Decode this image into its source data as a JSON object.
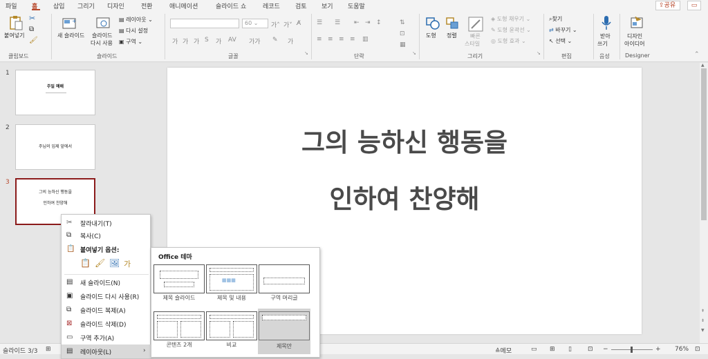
{
  "tabs": [
    "파일",
    "홈",
    "삽입",
    "그리기",
    "디자인",
    "전환",
    "애니메이션",
    "슬라이드 쇼",
    "레코드",
    "검토",
    "보기",
    "도움말"
  ],
  "share_label": "공유",
  "ribbon": {
    "paste_label": "붙여넣기",
    "new_slide_label": "새 슬라이드",
    "reuse_slides_label_1": "슬라이드",
    "reuse_slides_label_2": "다시 사용",
    "layout_label": "레이아웃",
    "reset_label": "다시 설정",
    "section_label": "구역",
    "font_size_value": "60",
    "shapes_label": "도형",
    "arrange_label": "정렬",
    "quick_styles_label_1": "빠른",
    "quick_styles_label_2": "스타일",
    "shape_fill_label": "도형 채우기",
    "shape_outline_label": "도형 윤곽선",
    "shape_effects_label": "도형 효과",
    "find_label": "찾기",
    "replace_label": "바꾸기",
    "select_label": "선택",
    "dictate_label_1": "받아",
    "dictate_label_2": "쓰기",
    "designer_label_1": "디자인",
    "designer_label_2": "아이디어",
    "groups": {
      "clipboard": "클립보드",
      "slides": "슬라이드",
      "font": "글꼴",
      "paragraph": "단락",
      "drawing": "그리기",
      "editing": "편집",
      "voice": "음성",
      "designer": "Designer"
    }
  },
  "thumbnails": [
    {
      "num": "1",
      "line1": "주일 예배",
      "line2": ""
    },
    {
      "num": "2",
      "line1": "주님의 입제 앞에서",
      "line2": ""
    },
    {
      "num": "3",
      "line1": "그의 능하신 행동을",
      "line2": "인하여 찬양해"
    }
  ],
  "slide": {
    "line1": "그의 능하신 행동을",
    "line2": "인하여 찬양해"
  },
  "context_menu": {
    "cut": "잘라내기(T)",
    "copy": "복사(C)",
    "paste_options": "붙여넣기 옵션:",
    "new_slide": "새 슬라이드(N)",
    "reuse_slides": "슬라이드 다시 사용(R)",
    "duplicate_slide": "슬라이드 복제(A)",
    "delete_slide": "슬라이드 삭제(D)",
    "add_section": "구역 추가(A)",
    "layout": "레이아웃(L)"
  },
  "layout_submenu": {
    "header": "Office 테마",
    "items": [
      "제목 슬라이드",
      "제목 및 내용",
      "구역 머리글",
      "콘텐츠 2개",
      "비교",
      "제목만"
    ]
  },
  "status": {
    "slide_counter": "슬라이드 3/3",
    "notes": "메모",
    "zoom": "76%"
  },
  "colors": {
    "accent": "#b7472a",
    "selected_border": "#8b1a1a"
  }
}
